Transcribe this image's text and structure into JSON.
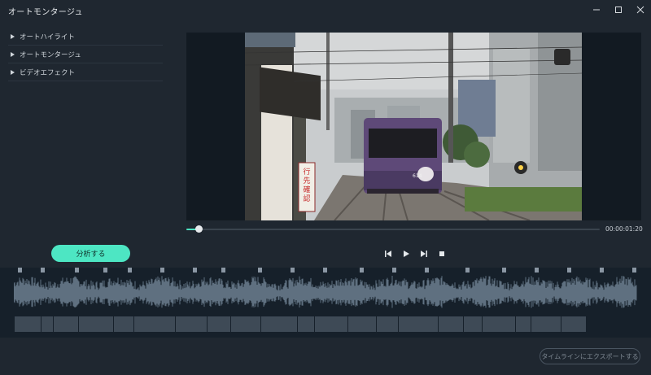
{
  "window": {
    "title": "オートモンタージュ",
    "controls": [
      "minimize-icon",
      "maximize-icon",
      "close-icon"
    ]
  },
  "sidebar": {
    "items": [
      {
        "label": "オートハイライト",
        "icon": "triangle-right-icon"
      },
      {
        "label": "オートモンタージュ",
        "icon": "triangle-right-icon"
      },
      {
        "label": "ビデオエフェクト",
        "icon": "triangle-right-icon"
      }
    ]
  },
  "preview": {
    "image": "tram-on-railway-tracks",
    "sign_text": "行先確認",
    "tram_number": "614"
  },
  "playback": {
    "progress": 0.03,
    "timecode": "00:00:01:20",
    "buttons": [
      "prev-frame-icon",
      "play-icon",
      "next-frame-icon",
      "stop-icon"
    ]
  },
  "actions": {
    "analyze_label": "分析する",
    "export_label": "タイムラインにエクスポートする"
  },
  "colors": {
    "accent": "#4de6c3",
    "background": "#1f2730",
    "timeline_bg": "#16202a",
    "clip": "#3e4a56",
    "waveform": "#5f7080"
  }
}
